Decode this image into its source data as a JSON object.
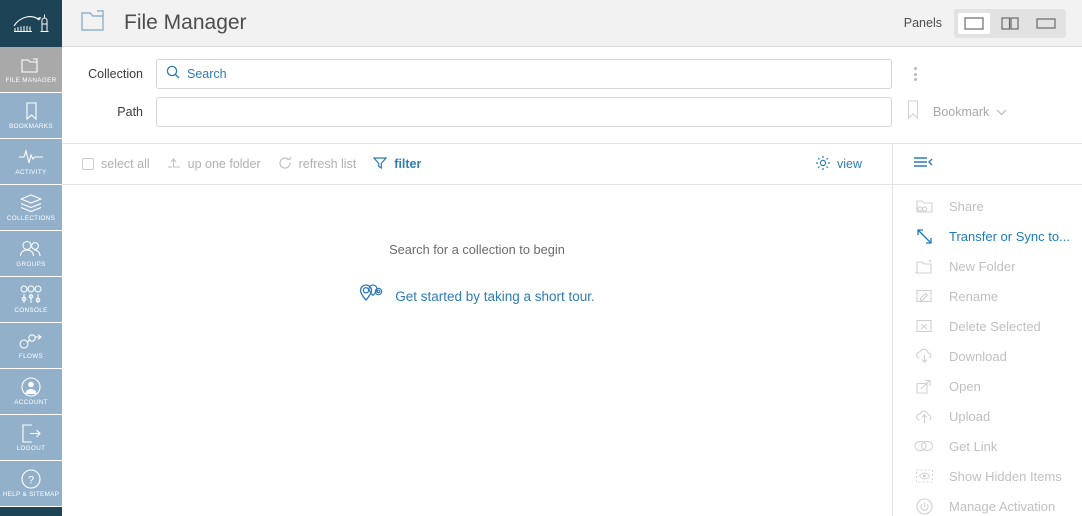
{
  "brand": {
    "logo_icon": "bridge-building-logo",
    "bg": "#1d4356"
  },
  "header": {
    "icon": "folder-icon",
    "title": "File Manager",
    "panels_label": "Panels",
    "panel_buttons": [
      {
        "icon": "panel-single-icon",
        "selected": true
      },
      {
        "icon": "panel-split-icon",
        "selected": false
      },
      {
        "icon": "panel-wide-icon",
        "selected": false
      }
    ]
  },
  "sidebar": {
    "items": [
      {
        "label": "FILE MANAGER",
        "icon": "folder-icon",
        "active": true
      },
      {
        "label": "BOOKMARKS",
        "icon": "bookmark-icon",
        "active": false
      },
      {
        "label": "ACTIVITY",
        "icon": "activity-pulse-icon",
        "active": false
      },
      {
        "label": "COLLECTIONS",
        "icon": "layers-icon",
        "active": false
      },
      {
        "label": "GROUPS",
        "icon": "people-icon",
        "active": false
      },
      {
        "label": "CONSOLE",
        "icon": "sliders-icon",
        "active": false
      },
      {
        "label": "FLOWS",
        "icon": "flows-nodes-icon",
        "active": false
      },
      {
        "label": "ACCOUNT",
        "icon": "user-circle-icon",
        "active": false
      },
      {
        "label": "LOGOUT",
        "icon": "logout-arrow-icon",
        "active": false
      },
      {
        "label": "HELP & SITEMAP",
        "icon": "question-circle-icon",
        "active": false
      }
    ]
  },
  "search": {
    "collection_label": "Collection",
    "collection_icon": "search-icon",
    "collection_placeholder": "Search",
    "collection_value": "",
    "path_label": "Path",
    "path_placeholder": "",
    "path_value": "",
    "kebab_icon": "more-vertical-icon",
    "bookmark_icon": "bookmark-icon",
    "bookmark_label": "Bookmark",
    "bookmark_caret": "chevron-down-icon"
  },
  "toolbar": {
    "select_all": "select all",
    "up_one_folder": "up one folder",
    "up_icon": "arrow-up-folder-icon",
    "refresh_list": "refresh list",
    "refresh_icon": "refresh-icon",
    "filter": "filter",
    "filter_icon": "funnel-icon",
    "view": "view",
    "view_icon": "gear-icon",
    "hamburger_icon": "hamburger-collapse-icon"
  },
  "main": {
    "empty_message": "Search for a collection to begin",
    "tour_icon": "map-pins-icon",
    "tour_text": "Get started by taking a short tour."
  },
  "actions": {
    "items": [
      {
        "label": "Share",
        "icon": "share-folder-icon",
        "enabled": false
      },
      {
        "label": "Transfer or Sync to...",
        "icon": "transfer-arrows-icon",
        "enabled": true
      },
      {
        "label": "New Folder",
        "icon": "new-folder-icon",
        "enabled": false
      },
      {
        "label": "Rename",
        "icon": "rename-pencil-icon",
        "enabled": false
      },
      {
        "label": "Delete Selected",
        "icon": "delete-x-icon",
        "enabled": false
      },
      {
        "label": "Download",
        "icon": "download-cloud-icon",
        "enabled": false
      },
      {
        "label": "Open",
        "icon": "open-external-icon",
        "enabled": false
      },
      {
        "label": "Upload",
        "icon": "upload-cloud-icon",
        "enabled": false
      },
      {
        "label": "Get Link",
        "icon": "link-icon",
        "enabled": false
      },
      {
        "label": "Show Hidden Items",
        "icon": "eye-dashed-icon",
        "enabled": false
      },
      {
        "label": "Manage Activation",
        "icon": "power-icon",
        "enabled": false
      }
    ]
  },
  "colors": {
    "accent": "#2e7cb8",
    "link": "#1b7cba",
    "rail": "#92b0c9",
    "rail_active": "#a9a9a9",
    "navy": "#1d4356"
  }
}
